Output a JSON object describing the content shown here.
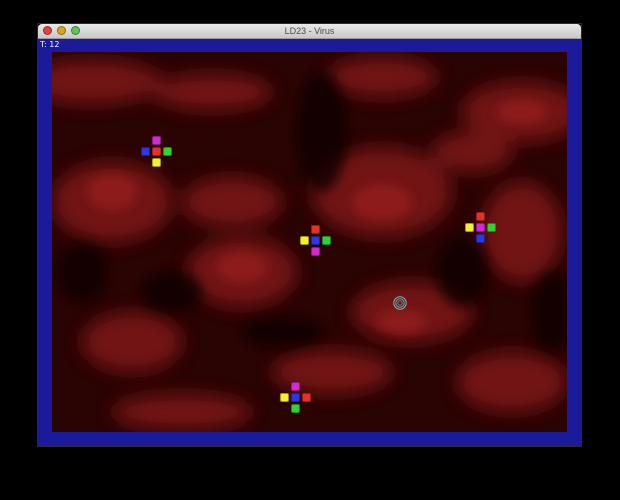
{
  "window": {
    "title": "LD23 - Virus",
    "titlebar_color": "#d4d4d4",
    "buttons": [
      {
        "name": "close",
        "color": "#e0443e"
      },
      {
        "name": "minimize",
        "color": "#dea123"
      },
      {
        "name": "zoom",
        "color": "#62c554"
      }
    ]
  },
  "hud": {
    "timer_label": "T:",
    "timer_value": "12"
  },
  "colors": {
    "border_blue": "#1a1a9a",
    "tissue_dark": "#2a0303",
    "tissue_red": "#8e1a1a",
    "red": "#e8302a",
    "green": "#2fd42f",
    "blue": "#2a38e8",
    "yellow": "#f2f22a",
    "magenta": "#d42ad4",
    "player_ring": "#6fbfbf"
  },
  "viruses": [
    {
      "top": "magenta",
      "left": "blue",
      "center": "red",
      "right": "green",
      "bottom": "yellow"
    },
    {
      "top": "red",
      "left": "yellow",
      "center": "blue",
      "right": "green",
      "bottom": "magenta"
    },
    {
      "top": "red",
      "left": "yellow",
      "center": "magenta",
      "right": "green",
      "bottom": "blue"
    },
    {
      "top": "magenta",
      "left": "yellow",
      "center": "blue",
      "right": "red",
      "bottom": "green"
    }
  ],
  "player": {
    "icon": "concentric-ring-icon"
  }
}
